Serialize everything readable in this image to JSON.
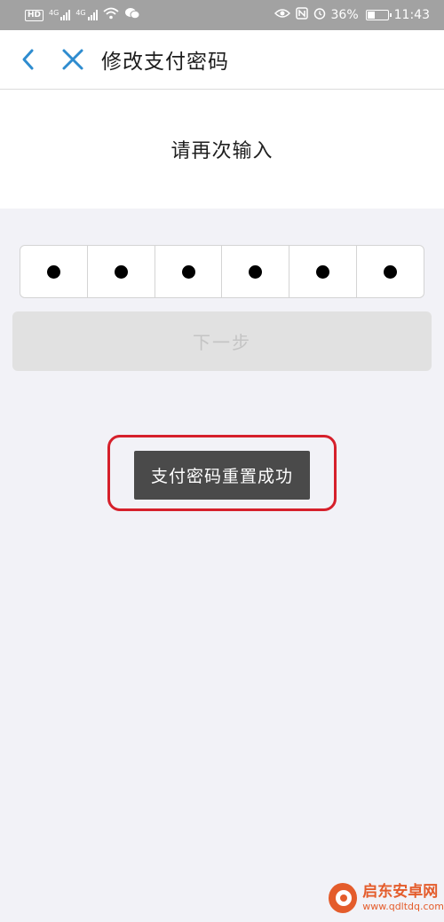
{
  "status_bar": {
    "hd_label": "HD",
    "net1_label": "4G",
    "net2_label": "4G",
    "battery_percent": "36%",
    "time": "11:43",
    "icons": [
      "wifi-icon",
      "wechat-icon",
      "eye-icon",
      "nfc-icon",
      "alarm-icon",
      "battery-icon"
    ]
  },
  "nav": {
    "title": "修改支付密码",
    "back_icon": "chevron-left-icon",
    "close_icon": "close-icon",
    "accent_color": "#2e8ccf"
  },
  "prompt": {
    "text": "请再次输入"
  },
  "password": {
    "length": 6,
    "filled": 6
  },
  "next_button": {
    "label": "下一步",
    "enabled": false
  },
  "toast": {
    "message": "支付密码重置成功"
  },
  "watermark": {
    "name": "启东安卓网",
    "url": "www.qdltdq.com"
  }
}
